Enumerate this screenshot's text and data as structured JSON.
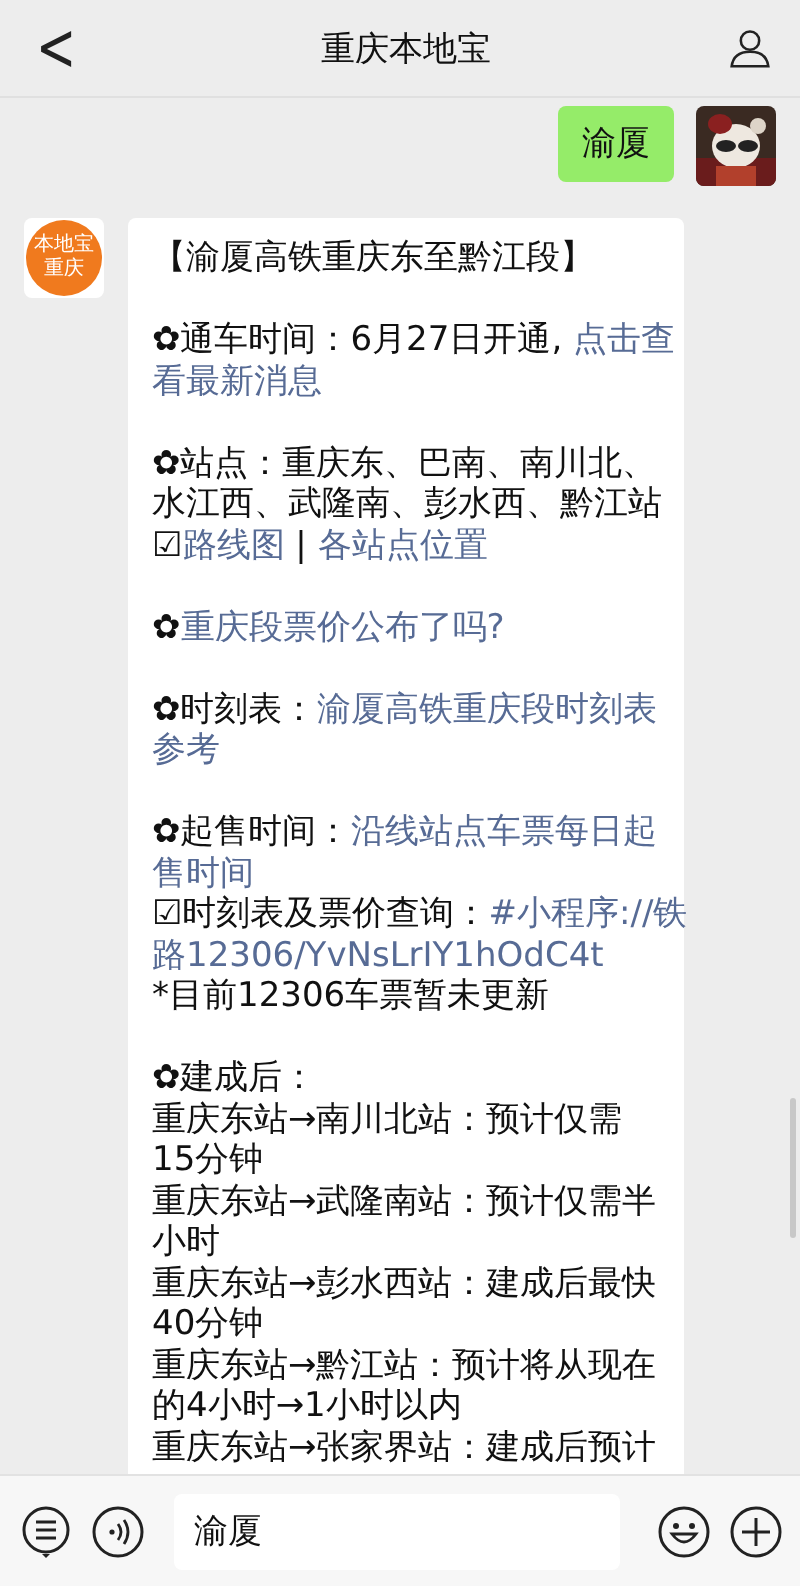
{
  "header": {
    "back": "<",
    "title": "重庆本地宝"
  },
  "sent": {
    "text": "渝厦"
  },
  "account_logo": {
    "brand": "本地宝",
    "city": "重庆"
  },
  "message": {
    "paragraphs": [
      {
        "lines": [
          [
            {
              "text": "【渝厦高铁重庆东至黔江段】",
              "link": false
            }
          ]
        ]
      },
      {
        "lines": [
          [
            {
              "text": "✿通车时间：6月27日开通, ",
              "link": false
            },
            {
              "text": "点击查",
              "link": true
            }
          ],
          [
            {
              "text": "看最新消息",
              "link": true
            }
          ]
        ]
      },
      {
        "lines": [
          [
            {
              "text": "✿站点：重庆东、巴南、南川北、",
              "link": false
            }
          ],
          [
            {
              "text": "水江西、武隆南、彭水西、黔江站",
              "link": false
            }
          ],
          [
            {
              "text": "☑",
              "link": false
            },
            {
              "text": "路线图",
              "link": true
            },
            {
              "text": " | ",
              "link": false
            },
            {
              "text": "各站点位置",
              "link": true
            }
          ]
        ]
      },
      {
        "lines": [
          [
            {
              "text": "✿",
              "link": false
            },
            {
              "text": "重庆段票价公布了吗?",
              "link": true
            }
          ]
        ]
      },
      {
        "lines": [
          [
            {
              "text": "✿时刻表：",
              "link": false
            },
            {
              "text": "渝厦高铁重庆段时刻表",
              "link": true
            }
          ],
          [
            {
              "text": "参考",
              "link": true
            }
          ]
        ]
      },
      {
        "lines": [
          [
            {
              "text": "✿起售时间：",
              "link": false
            },
            {
              "text": "沿线站点车票每日起",
              "link": true
            }
          ],
          [
            {
              "text": "售时间",
              "link": true
            }
          ],
          [
            {
              "text": "☑时刻表及票价查询：",
              "link": false
            },
            {
              "text": "#小程序://铁",
              "link": true
            }
          ],
          [
            {
              "text": "路12306/YvNsLrIY1hOdC4t",
              "link": true
            }
          ],
          [
            {
              "text": "*目前12306车票暂未更新",
              "link": false
            }
          ]
        ]
      },
      {
        "lines": [
          [
            {
              "text": "✿建成后：",
              "link": false
            }
          ],
          [
            {
              "text": "重庆东站→南川北站：预计仅需",
              "link": false
            }
          ],
          [
            {
              "text": "15分钟",
              "link": false
            }
          ],
          [
            {
              "text": "重庆东站→武隆南站：预计仅需半",
              "link": false
            }
          ],
          [
            {
              "text": "小时",
              "link": false
            }
          ],
          [
            {
              "text": "重庆东站→彭水西站：建成后最快",
              "link": false
            }
          ],
          [
            {
              "text": "40分钟",
              "link": false
            }
          ],
          [
            {
              "text": "重庆东站→黔江站：预计将从现在",
              "link": false
            }
          ],
          [
            {
              "text": "的4小时→1小时以内",
              "link": false
            }
          ],
          [
            {
              "text": "重庆东站→张家界站：建成后预计",
              "link": false
            }
          ]
        ]
      }
    ]
  },
  "input": {
    "value": "渝厦"
  }
}
